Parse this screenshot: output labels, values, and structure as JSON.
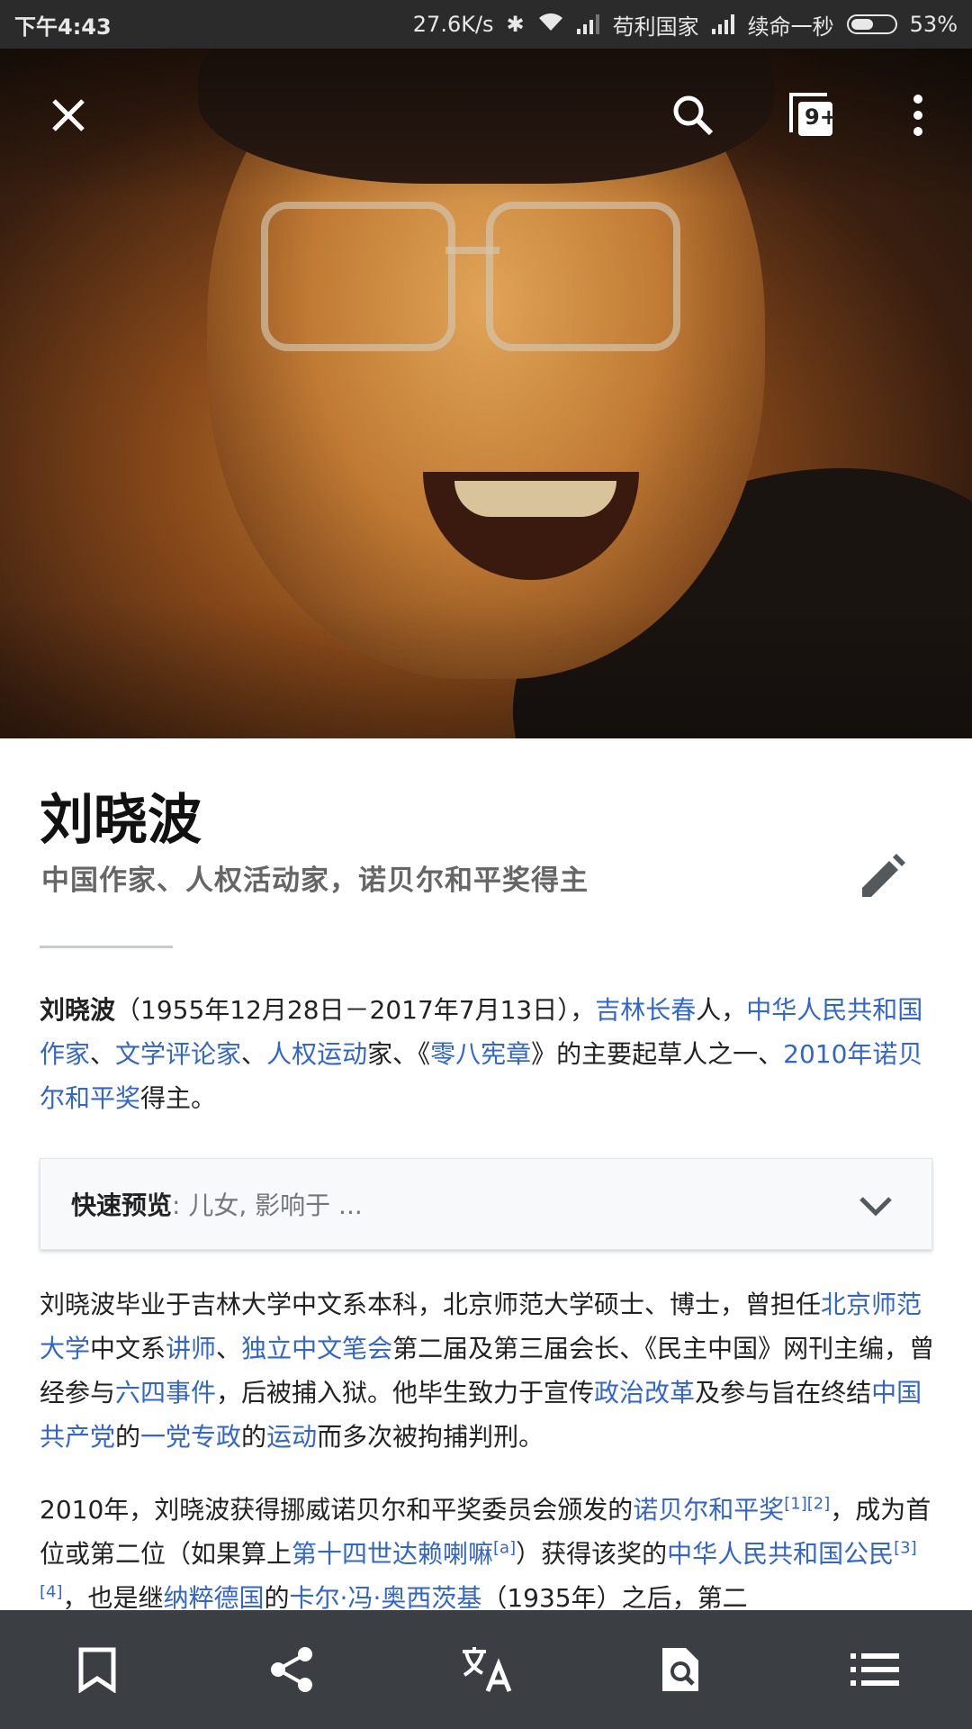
{
  "status_bar": {
    "time": "下午4:43",
    "net_speed": "27.6K/s",
    "carrier1": "苟利国家",
    "carrier2": "续命一秒",
    "battery": "53%",
    "battery_level": 0.53
  },
  "header": {
    "tabs_badge": "9+",
    "icons": [
      "close-icon",
      "search-icon",
      "tabs-icon",
      "more-vert-icon"
    ]
  },
  "article": {
    "title": "刘晓波",
    "description": "中国作家、人权活动家，诺贝尔和平奖得主"
  },
  "p1": {
    "bold": "刘晓波",
    "t1": "（1955年12月28日－2017年7月13日），",
    "l1": "吉林长春",
    "t2": "人，",
    "l2": "中华人民共和国作家",
    "t3": "、",
    "l3": "文学评论家",
    "t4": "、",
    "l4": "人权运动",
    "t5": "家、《",
    "l5": "零八宪章",
    "t6": "》的主要起草人之一、",
    "l6": "2010年诺贝尔和平奖",
    "t7": "得主。"
  },
  "quick_facts": {
    "label": "快速预览",
    "value": ": 儿女, 影响于 ..."
  },
  "p2": {
    "t1": "刘晓波毕业于吉林大学中文系本科，北京师范大学硕士、博士，曾担任",
    "l1": "北京师范大学",
    "t2": "中文系",
    "l2": "讲师",
    "t3": "、",
    "l3": "独立中文笔会",
    "t4": "第二届及第三届会长、《民主中国》网刊主编，曾经参与",
    "l4": "六四事件",
    "t5": "，后被捕入狱。他毕生致力于宣传",
    "l5": "政治改革",
    "t6": "及参与旨在终结",
    "l6": "中国共产党",
    "t7": "的",
    "l7": "一党专政",
    "t8": "的",
    "l8": "运动",
    "t9": "而多次被拘捕判刑。"
  },
  "p3": {
    "t1": "2010年，刘晓波获得挪威诺贝尔和平奖委员会颁发的",
    "l1": "诺贝尔和平奖",
    "s1": "[1][2]",
    "t2": "，成为首位或第二位（如果算上",
    "l2": "第十四世达赖喇嘛",
    "s2": "[a]",
    "t3": "）获得该奖的",
    "l3": "中华人民共和国公民",
    "s3": "[3][4]",
    "t4": "，也是继",
    "l4": "纳粹德国",
    "t5": "的",
    "l5": "卡尔·冯·奥西茨基",
    "t6": "（1935年）之后，第二"
  },
  "toolbar": {
    "icons": [
      "bookmark-icon",
      "share-icon",
      "translate-icon",
      "find-in-page-icon",
      "table-of-contents-icon"
    ]
  },
  "colors": {
    "link": "#3366cc",
    "toolbar_bg": "#3b3e42",
    "status_bg": "#2b2b2b"
  }
}
